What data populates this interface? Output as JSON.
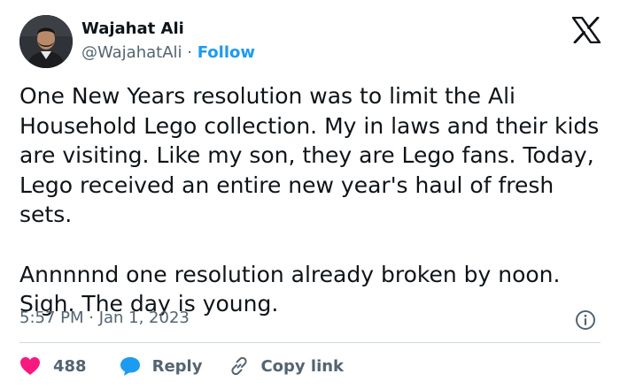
{
  "author": {
    "name": "Wajahat Ali",
    "handle": "@WajahatAli",
    "separator": "·",
    "follow_label": "Follow"
  },
  "tweet": {
    "paragraphs": [
      "One New Years resolution was to limit the Ali Household Lego collection. My in laws and their kids are visiting. Like my son, they are Lego fans. Today, Lego received an entire new year's haul of fresh sets.",
      "Annnnnd one resolution already broken by noon. Sigh. The day is young."
    ],
    "timestamp": "5:57 PM · Jan 1, 2023"
  },
  "actions": {
    "like_count": "488",
    "reply_label": "Reply",
    "copy_label": "Copy link"
  },
  "icons": {
    "logo": "x-logo-icon",
    "info": "info-icon",
    "like": "heart-icon",
    "reply": "speech-bubble-icon",
    "copy": "link-icon"
  },
  "colors": {
    "text": "#0f1419",
    "muted": "#536471",
    "follow": "#1d9bf0",
    "heart": "#f91880",
    "reply_bubble": "#1d9bf0",
    "divider": "#cfd9de"
  }
}
